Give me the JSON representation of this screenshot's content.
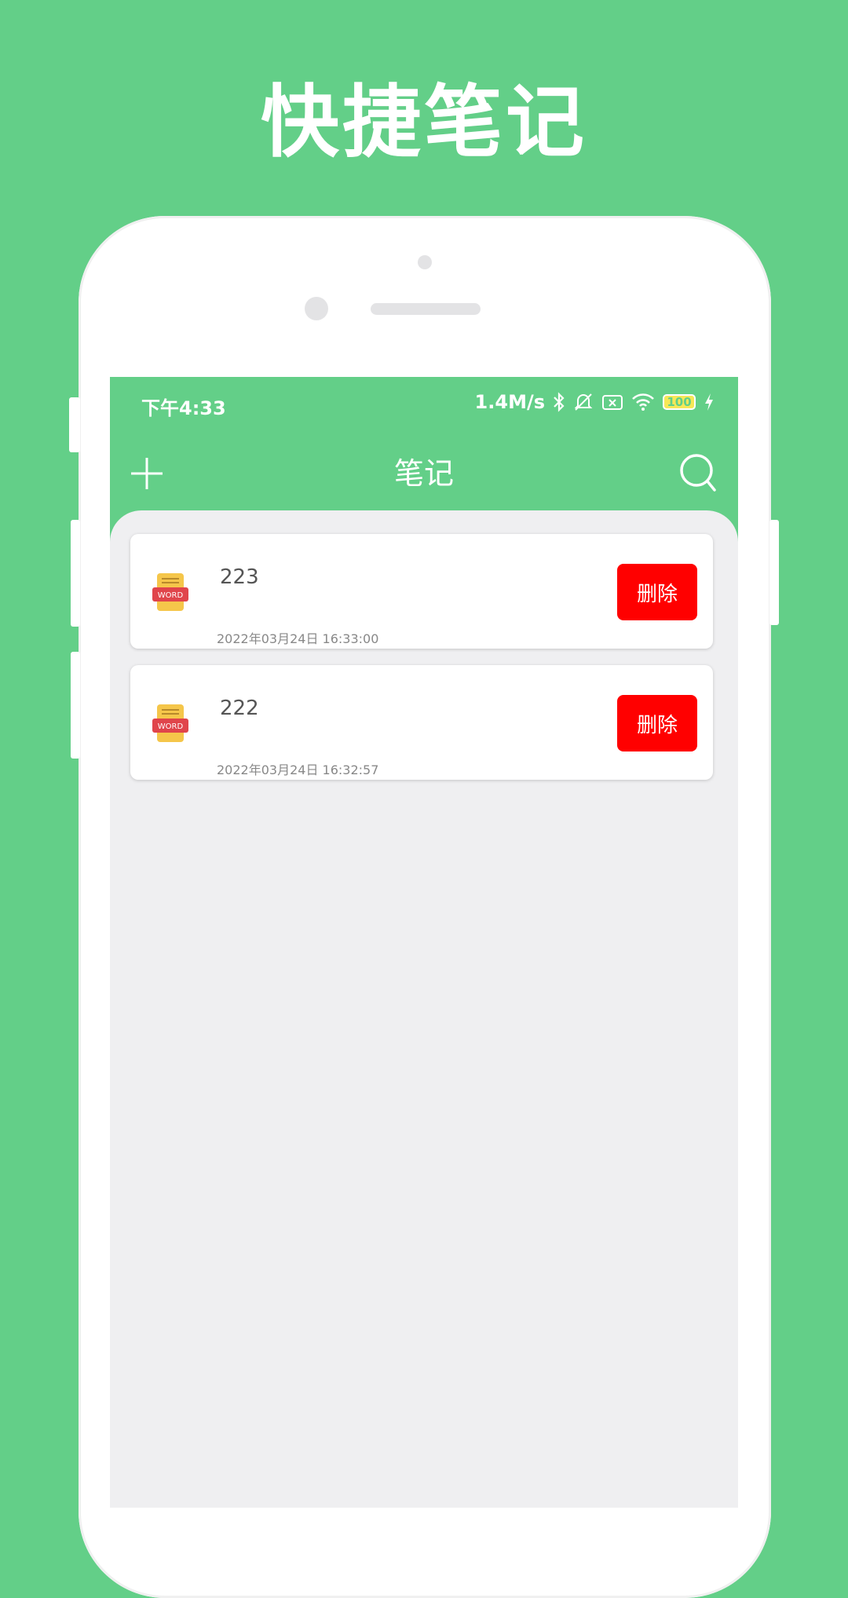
{
  "promo": {
    "title": "快捷笔记"
  },
  "status_bar": {
    "time": "下午4:33",
    "network_speed": "1.4M/s",
    "battery": "100",
    "icons": [
      "bluetooth-icon",
      "mute-icon",
      "sim-icon",
      "wifi-icon",
      "battery-icon",
      "charging-icon"
    ]
  },
  "app_bar": {
    "title": "笔记",
    "add_icon": "plus-icon",
    "search_icon": "search-icon"
  },
  "notes": [
    {
      "title": "223",
      "date": "2022年03月24日 16:33:00",
      "delete_label": "删除",
      "icon": "word-doc-icon",
      "icon_label": "WORD"
    },
    {
      "title": "222",
      "date": "2022年03月24日 16:32:57",
      "delete_label": "删除",
      "icon": "word-doc-icon",
      "icon_label": "WORD"
    }
  ],
  "colors": {
    "background": "#63cf88",
    "delete": "#ff0000",
    "content_bg": "#efeff1"
  }
}
